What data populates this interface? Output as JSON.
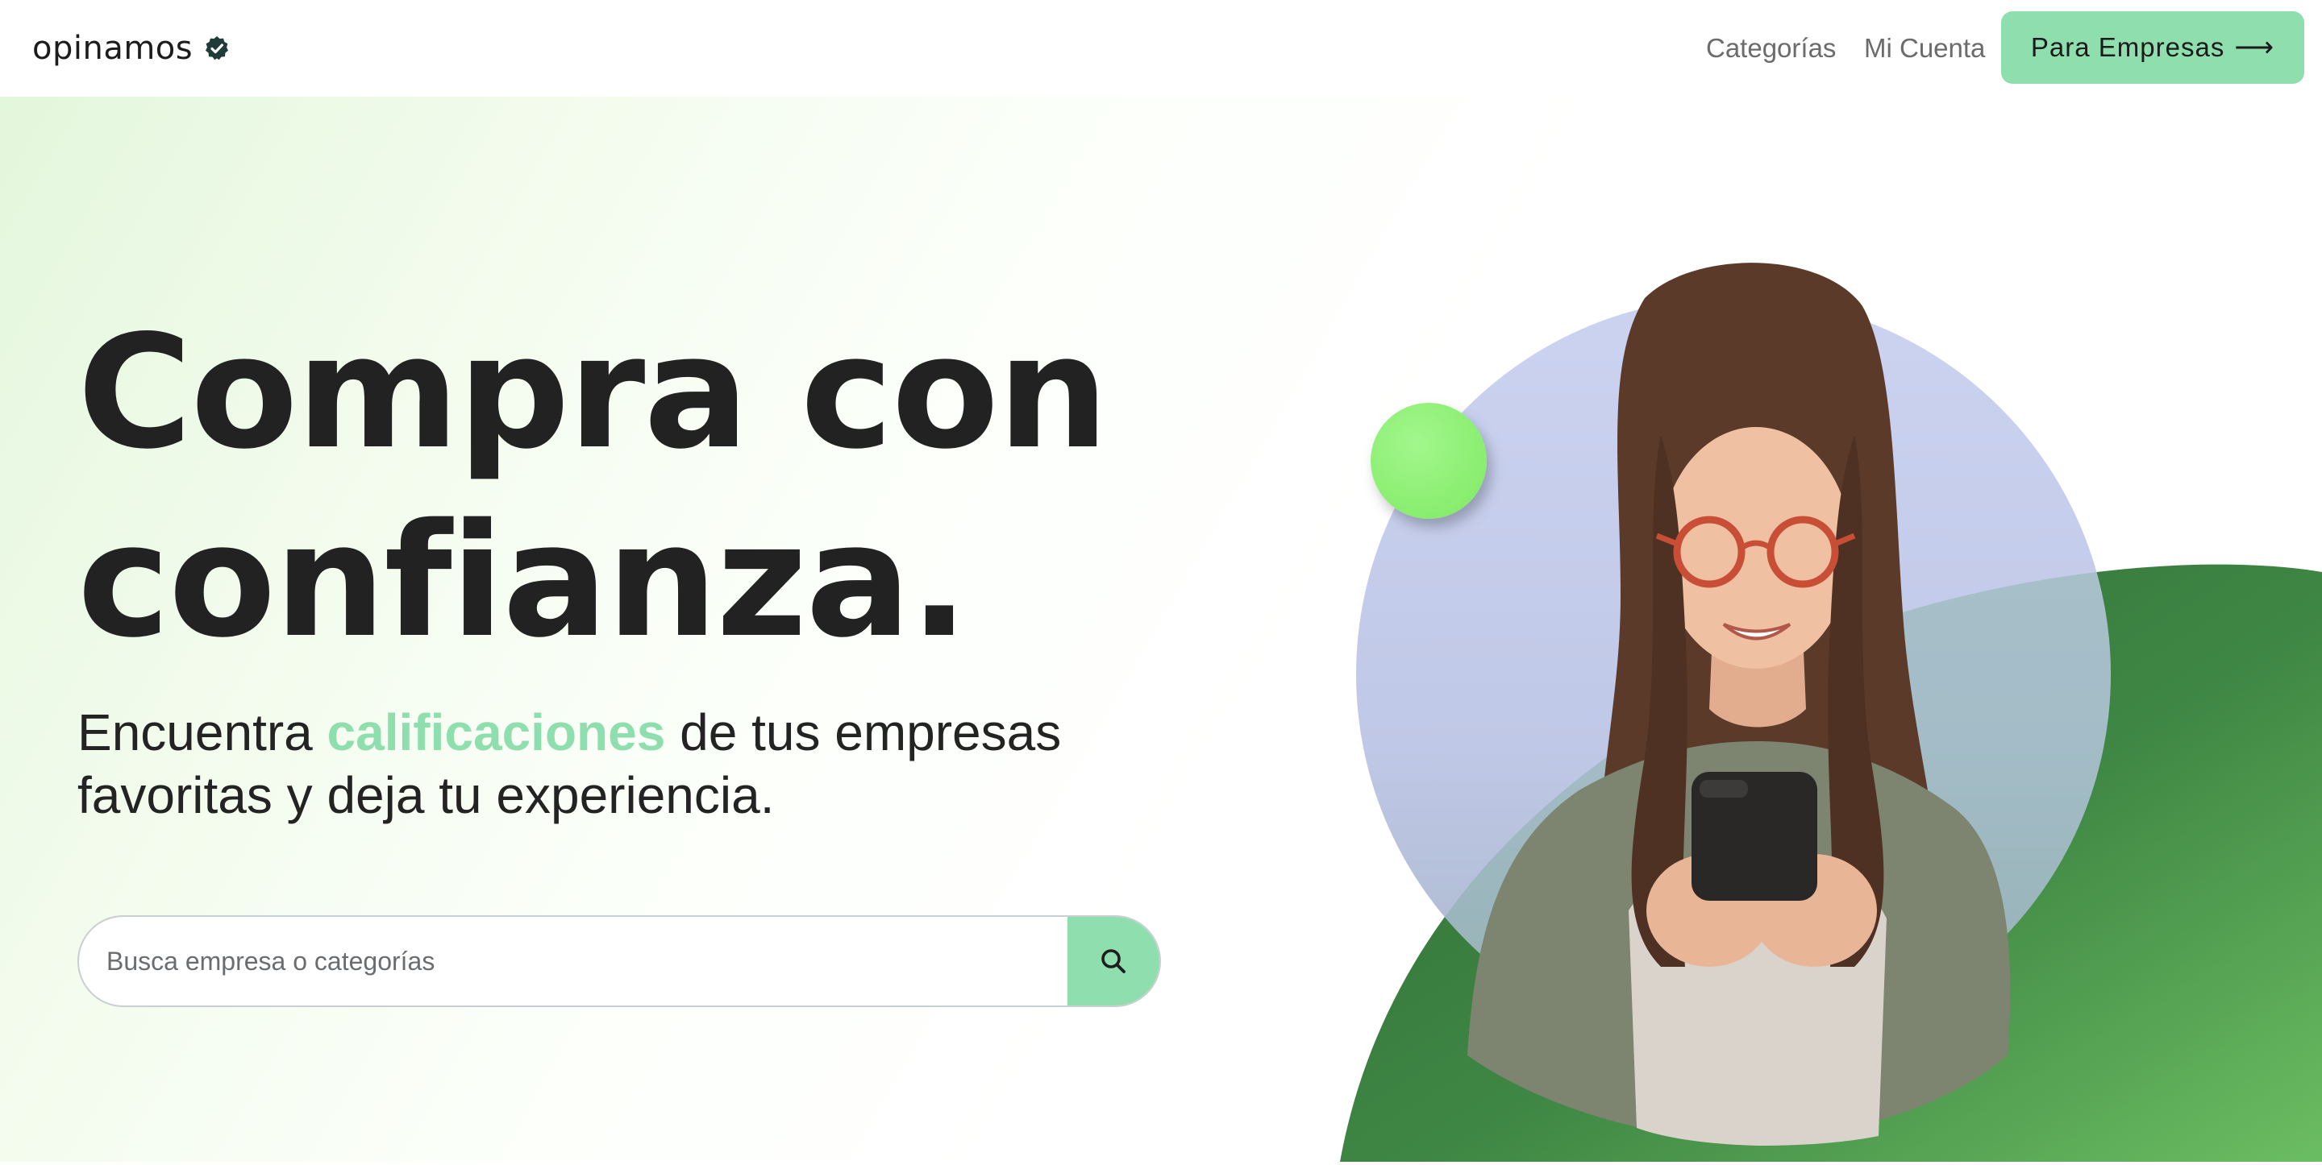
{
  "header": {
    "logo_text": "opinamos",
    "nav": {
      "categories": "Categorías",
      "account": "Mi Cuenta"
    },
    "cta_label": "Para Empresas",
    "cta_arrow": "⟶"
  },
  "hero": {
    "headline_line1": "Compra con",
    "headline_line2": "confianza.",
    "subtitle_before": "Encuentra ",
    "subtitle_highlight": "calificaciones",
    "subtitle_after": " de tus empresas favoritas y deja tu experiencia.",
    "search": {
      "placeholder": "Busca empresa o categorías",
      "value": ""
    },
    "image": {
      "subject": "smiling woman with red glasses holding a smartphone"
    }
  },
  "icons": {
    "logo_badge": "verified-check-icon",
    "search": "search-icon",
    "arrow": "arrow-right-icon"
  },
  "colors": {
    "accent": "#8fdfae",
    "text": "#222222",
    "nav_text": "#6b6b6b",
    "dark_green": "#3d7a3e",
    "light_green_dot": "#96f47c",
    "lavender_circle": "#c5cdee"
  }
}
